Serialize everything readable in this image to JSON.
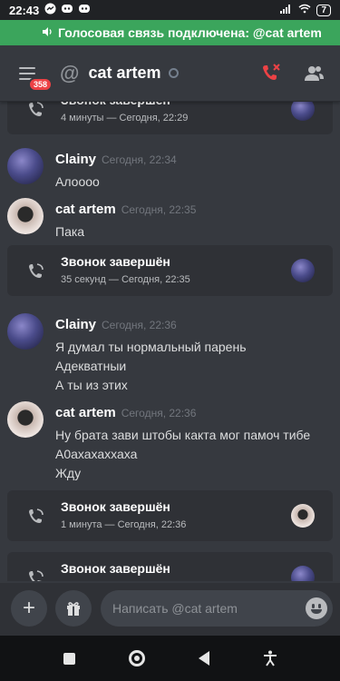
{
  "statusbar": {
    "time": "22:43",
    "battery": "7",
    "icons": [
      "messenger-icon",
      "discord-icon",
      "discord-icon"
    ]
  },
  "voice": {
    "text": "Голосовая связь подключена: @cat artem"
  },
  "header": {
    "at": "@",
    "title": "cat artem",
    "badge": "358"
  },
  "messages": {
    "call0": {
      "title": "Звонок завершён",
      "sub": "4 минуты — Сегодня, 22:29"
    },
    "m1": {
      "author": "Clainy",
      "time": "Сегодня, 22:34",
      "lines": [
        "Алоооо"
      ]
    },
    "m2": {
      "author": "cat artem",
      "time": "Сегодня, 22:35",
      "lines": [
        "Пака"
      ]
    },
    "call1": {
      "title": "Звонок завершён",
      "sub": "35 секунд — Сегодня, 22:35"
    },
    "m3": {
      "author": "Clainy",
      "time": "Сегодня, 22:36",
      "lines": [
        "Я думал ты нормальный парень",
        "Адекватныи",
        "А ты из этих"
      ]
    },
    "m4": {
      "author": "cat artem",
      "time": "Сегодня, 22:36",
      "lines": [
        "Ну  брата зави штобы какта мог памоч тибе",
        "А0ахахаххаха",
        "Жду"
      ]
    },
    "call2": {
      "title": "Звонок завершён",
      "sub": "1 минута — Сегодня, 22:36"
    },
    "call3": {
      "title": "Звонок завершён",
      "sub": ""
    }
  },
  "composer": {
    "placeholder": "Написать @cat artem",
    "add": "+"
  },
  "colors": {
    "accent_green": "#3ba55c",
    "danger_red": "#ed4245",
    "background": "#36393f"
  }
}
